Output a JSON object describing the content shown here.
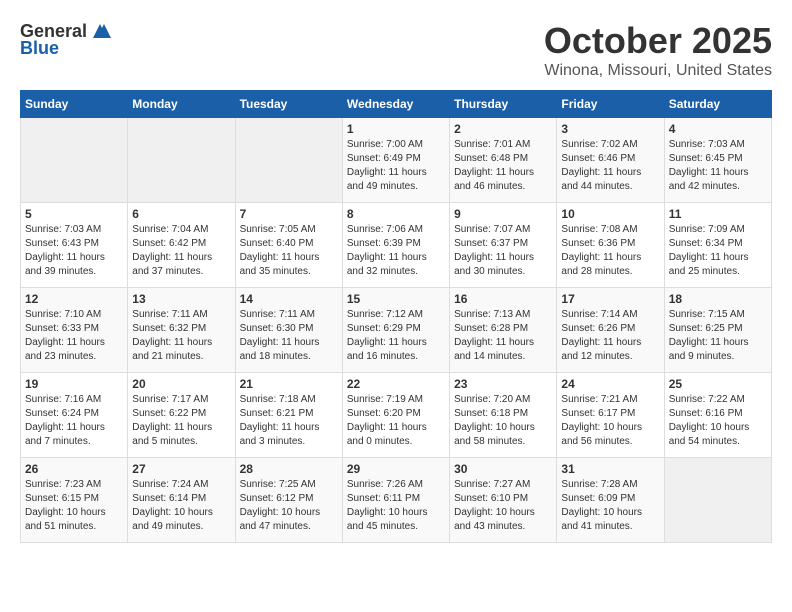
{
  "logo": {
    "general": "General",
    "blue": "Blue"
  },
  "header": {
    "month": "October 2025",
    "location": "Winona, Missouri, United States"
  },
  "weekdays": [
    "Sunday",
    "Monday",
    "Tuesday",
    "Wednesday",
    "Thursday",
    "Friday",
    "Saturday"
  ],
  "weeks": [
    [
      {
        "day": "",
        "info": ""
      },
      {
        "day": "",
        "info": ""
      },
      {
        "day": "",
        "info": ""
      },
      {
        "day": "1",
        "info": "Sunrise: 7:00 AM\nSunset: 6:49 PM\nDaylight: 11 hours\nand 49 minutes."
      },
      {
        "day": "2",
        "info": "Sunrise: 7:01 AM\nSunset: 6:48 PM\nDaylight: 11 hours\nand 46 minutes."
      },
      {
        "day": "3",
        "info": "Sunrise: 7:02 AM\nSunset: 6:46 PM\nDaylight: 11 hours\nand 44 minutes."
      },
      {
        "day": "4",
        "info": "Sunrise: 7:03 AM\nSunset: 6:45 PM\nDaylight: 11 hours\nand 42 minutes."
      }
    ],
    [
      {
        "day": "5",
        "info": "Sunrise: 7:03 AM\nSunset: 6:43 PM\nDaylight: 11 hours\nand 39 minutes."
      },
      {
        "day": "6",
        "info": "Sunrise: 7:04 AM\nSunset: 6:42 PM\nDaylight: 11 hours\nand 37 minutes."
      },
      {
        "day": "7",
        "info": "Sunrise: 7:05 AM\nSunset: 6:40 PM\nDaylight: 11 hours\nand 35 minutes."
      },
      {
        "day": "8",
        "info": "Sunrise: 7:06 AM\nSunset: 6:39 PM\nDaylight: 11 hours\nand 32 minutes."
      },
      {
        "day": "9",
        "info": "Sunrise: 7:07 AM\nSunset: 6:37 PM\nDaylight: 11 hours\nand 30 minutes."
      },
      {
        "day": "10",
        "info": "Sunrise: 7:08 AM\nSunset: 6:36 PM\nDaylight: 11 hours\nand 28 minutes."
      },
      {
        "day": "11",
        "info": "Sunrise: 7:09 AM\nSunset: 6:34 PM\nDaylight: 11 hours\nand 25 minutes."
      }
    ],
    [
      {
        "day": "12",
        "info": "Sunrise: 7:10 AM\nSunset: 6:33 PM\nDaylight: 11 hours\nand 23 minutes."
      },
      {
        "day": "13",
        "info": "Sunrise: 7:11 AM\nSunset: 6:32 PM\nDaylight: 11 hours\nand 21 minutes."
      },
      {
        "day": "14",
        "info": "Sunrise: 7:11 AM\nSunset: 6:30 PM\nDaylight: 11 hours\nand 18 minutes."
      },
      {
        "day": "15",
        "info": "Sunrise: 7:12 AM\nSunset: 6:29 PM\nDaylight: 11 hours\nand 16 minutes."
      },
      {
        "day": "16",
        "info": "Sunrise: 7:13 AM\nSunset: 6:28 PM\nDaylight: 11 hours\nand 14 minutes."
      },
      {
        "day": "17",
        "info": "Sunrise: 7:14 AM\nSunset: 6:26 PM\nDaylight: 11 hours\nand 12 minutes."
      },
      {
        "day": "18",
        "info": "Sunrise: 7:15 AM\nSunset: 6:25 PM\nDaylight: 11 hours\nand 9 minutes."
      }
    ],
    [
      {
        "day": "19",
        "info": "Sunrise: 7:16 AM\nSunset: 6:24 PM\nDaylight: 11 hours\nand 7 minutes."
      },
      {
        "day": "20",
        "info": "Sunrise: 7:17 AM\nSunset: 6:22 PM\nDaylight: 11 hours\nand 5 minutes."
      },
      {
        "day": "21",
        "info": "Sunrise: 7:18 AM\nSunset: 6:21 PM\nDaylight: 11 hours\nand 3 minutes."
      },
      {
        "day": "22",
        "info": "Sunrise: 7:19 AM\nSunset: 6:20 PM\nDaylight: 11 hours\nand 0 minutes."
      },
      {
        "day": "23",
        "info": "Sunrise: 7:20 AM\nSunset: 6:18 PM\nDaylight: 10 hours\nand 58 minutes."
      },
      {
        "day": "24",
        "info": "Sunrise: 7:21 AM\nSunset: 6:17 PM\nDaylight: 10 hours\nand 56 minutes."
      },
      {
        "day": "25",
        "info": "Sunrise: 7:22 AM\nSunset: 6:16 PM\nDaylight: 10 hours\nand 54 minutes."
      }
    ],
    [
      {
        "day": "26",
        "info": "Sunrise: 7:23 AM\nSunset: 6:15 PM\nDaylight: 10 hours\nand 51 minutes."
      },
      {
        "day": "27",
        "info": "Sunrise: 7:24 AM\nSunset: 6:14 PM\nDaylight: 10 hours\nand 49 minutes."
      },
      {
        "day": "28",
        "info": "Sunrise: 7:25 AM\nSunset: 6:12 PM\nDaylight: 10 hours\nand 47 minutes."
      },
      {
        "day": "29",
        "info": "Sunrise: 7:26 AM\nSunset: 6:11 PM\nDaylight: 10 hours\nand 45 minutes."
      },
      {
        "day": "30",
        "info": "Sunrise: 7:27 AM\nSunset: 6:10 PM\nDaylight: 10 hours\nand 43 minutes."
      },
      {
        "day": "31",
        "info": "Sunrise: 7:28 AM\nSunset: 6:09 PM\nDaylight: 10 hours\nand 41 minutes."
      },
      {
        "day": "",
        "info": ""
      }
    ]
  ]
}
